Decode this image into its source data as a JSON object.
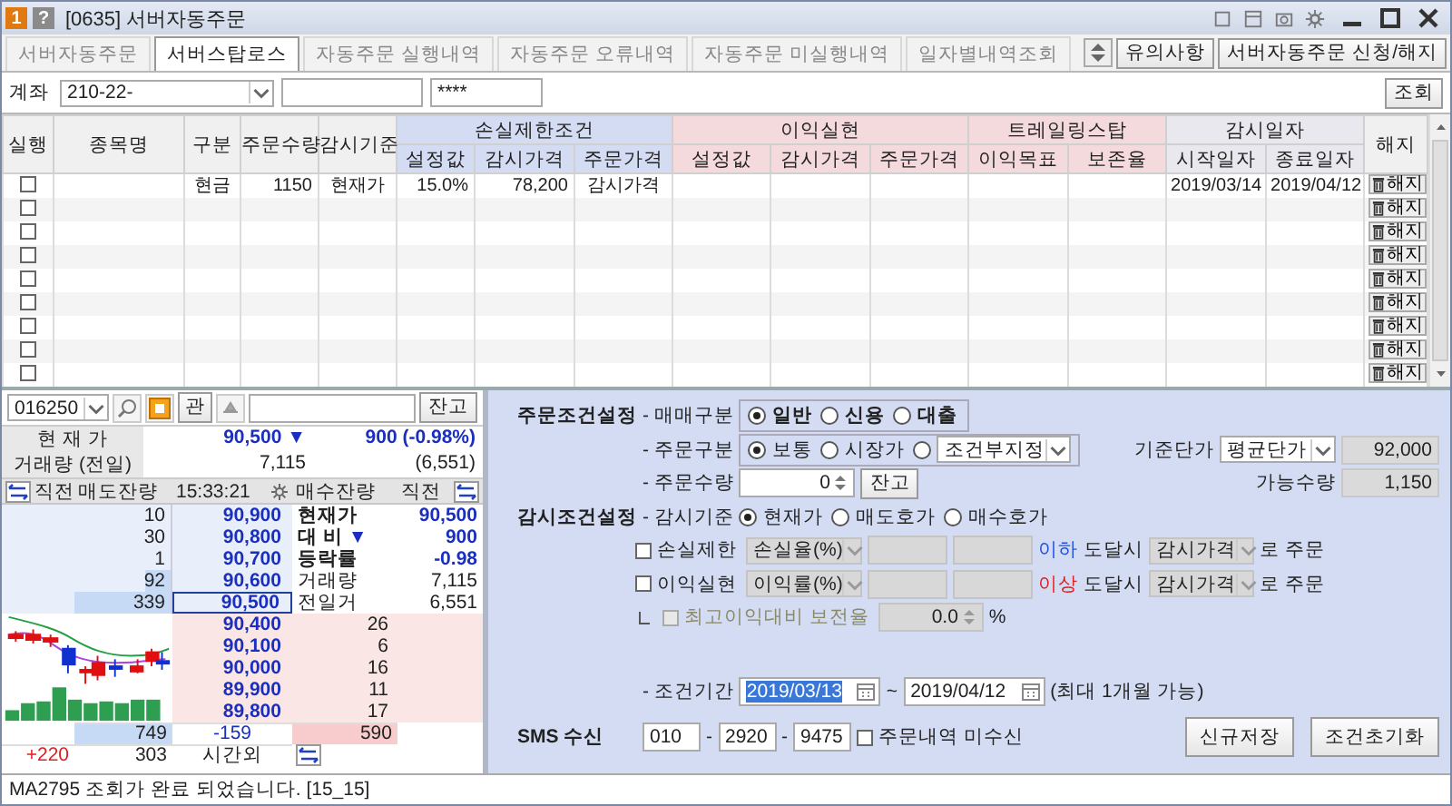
{
  "window": {
    "badge": "1",
    "help": "?",
    "title": "[0635] 서버자동주문"
  },
  "tabs": [
    {
      "label": "서버자동주문",
      "selected": false
    },
    {
      "label": "서버스탑로스",
      "selected": true
    },
    {
      "label": "자동주문 실행내역",
      "selected": false
    },
    {
      "label": "자동주문 오류내역",
      "selected": false
    },
    {
      "label": "자동주문 미실행내역",
      "selected": false
    },
    {
      "label": "일자별내역조회",
      "selected": false
    }
  ],
  "toolbar_buttons": [
    "유의사항",
    "서버자동주문 신청/해지"
  ],
  "account": {
    "label": "계좌",
    "number": "210-22-",
    "password": "****",
    "query_button": "조회"
  },
  "table": {
    "columns": [
      "실행",
      "종목명",
      "구분",
      "주문수량",
      "감시기준"
    ],
    "groups": [
      {
        "label": "손실제한조건",
        "columns": [
          "설정값",
          "감시가격",
          "주문가격"
        ]
      },
      {
        "label": "이익실현",
        "columns": [
          "설정값",
          "감시가격",
          "주문가격"
        ]
      },
      {
        "label": "트레일링스탑",
        "columns": [
          "이익목표",
          "보존율"
        ]
      },
      {
        "label": "감시일자",
        "columns": [
          "시작일자",
          "종료일자"
        ]
      }
    ],
    "last_column": "해지",
    "rows": [
      {
        "checked": false,
        "type": "현금",
        "quantity": "1150",
        "basis": "현재가",
        "loss_setting": "15.0%",
        "loss_watch_price": "78,200",
        "loss_order_price": "감시가격",
        "start_date": "2019/03/14",
        "end_date": "2019/04/12",
        "cancel": "해지"
      },
      {
        "checked": false,
        "cancel": "해지"
      },
      {
        "checked": false,
        "cancel": "해지"
      },
      {
        "checked": false,
        "cancel": "해지"
      },
      {
        "checked": false,
        "cancel": "해지"
      },
      {
        "checked": false,
        "cancel": "해지"
      },
      {
        "checked": false,
        "cancel": "해지"
      },
      {
        "checked": false,
        "cancel": "해지"
      },
      {
        "checked": false,
        "cancel": "해지"
      }
    ]
  },
  "quote": {
    "code": "016250",
    "buttons": [
      "관",
      "잔고"
    ],
    "price_label": "현 재 가",
    "price": "90,500",
    "arrow": "▼",
    "change": "900",
    "change_rate": "(-0.98%)",
    "volume_label": "거래량 (전일)",
    "volume": "7,115",
    "prev_volume": "(6,551)",
    "header": [
      "직전",
      "매도잔량",
      "15:33:21",
      "매수잔량",
      "직전"
    ],
    "asks": [
      {
        "qty": "10",
        "price": "90,900",
        "selected": false
      },
      {
        "qty": "30",
        "price": "90,800",
        "selected": false
      },
      {
        "qty": "1",
        "price": "90,700",
        "selected": false
      },
      {
        "qty": "92",
        "price": "90,600",
        "level": 0.27,
        "selected": false
      },
      {
        "qty": "339",
        "price": "90,500",
        "level": 1,
        "selected": true
      }
    ],
    "info": [
      {
        "label": "현재가",
        "value": "90,500",
        "emphasis": true
      },
      {
        "label": "대 비",
        "arrow": "▼",
        "value": "900",
        "emphasis": true
      },
      {
        "label": "등락률",
        "value": "-0.98",
        "emphasis": true
      },
      {
        "label": "거래량",
        "value": "7,115",
        "emphasis": false
      },
      {
        "label": "전일거",
        "value": "6,551",
        "emphasis": false
      }
    ],
    "bids": [
      {
        "price": "90,400",
        "qty": "26"
      },
      {
        "price": "90,100",
        "qty": "6"
      },
      {
        "price": "90,000",
        "qty": "16"
      },
      {
        "price": "89,900",
        "qty": "11"
      },
      {
        "price": "89,800",
        "qty": "17"
      }
    ],
    "totals": {
      "ask_total": "749",
      "diff": "-159",
      "bid_total": "590",
      "after_hours_prev": "+220",
      "after_hours_qty": "303",
      "after_hours_label": "시간외"
    }
  },
  "order_settings": {
    "title": "주문조건설정",
    "trade_type": {
      "label": "- 매매구분",
      "options": [
        {
          "label": "일반",
          "selected": true
        },
        {
          "label": "신용",
          "selected": false
        },
        {
          "label": "대출",
          "selected": false
        }
      ]
    },
    "order_type": {
      "label": "- 주문구분",
      "options": [
        {
          "label": "보통",
          "selected": true
        },
        {
          "label": "시장가",
          "selected": false
        },
        {
          "dropdown": "조건부지정",
          "selected": false
        }
      ]
    },
    "base_price": {
      "label": "기준단가",
      "dropdown": "평균단가",
      "value": "92,000"
    },
    "quantity": {
      "label": "- 주문수량",
      "value": "0",
      "button": "잔고"
    },
    "available": {
      "label": "가능수량",
      "value": "1,150"
    }
  },
  "watch_settings": {
    "title": "감시조건설정",
    "basis": {
      "label": "- 감시기준",
      "options": [
        {
          "label": "현재가",
          "selected": true
        },
        {
          "label": "매도호가",
          "selected": false
        },
        {
          "label": "매수호가",
          "selected": false
        }
      ]
    },
    "conditions": [
      {
        "label": "손실제한",
        "checked": false,
        "dropdown": "손실율(%)",
        "direction": "이하",
        "kind": "below",
        "reach": "도달시",
        "price_dropdown": "감시가격",
        "suffix": "로 주문"
      },
      {
        "label": "이익실현",
        "checked": false,
        "dropdown": "이익률(%)",
        "direction": "이상",
        "kind": "above",
        "reach": "도달시",
        "price_dropdown": "감시가격",
        "suffix": "로 주문"
      }
    ],
    "trailing": {
      "label": "최고이익대비 보전율",
      "checked": false,
      "disabled": true,
      "value": "0.0",
      "unit": "%"
    },
    "period": {
      "label": "- 조건기간",
      "start": "2019/03/13",
      "start_selected": true,
      "separator": "~",
      "end": "2019/04/12",
      "note": "(최대 1개월 가능)"
    }
  },
  "sms": {
    "label": "SMS 수신",
    "phone": [
      "010",
      "2920",
      "9475"
    ],
    "separator": "-",
    "opt_out": {
      "label": "주문내역 미수신",
      "checked": false
    }
  },
  "actions": [
    "신규저장",
    "조건초기화"
  ],
  "status_bar": {
    "message": "MA2795 조회가 완료 되었습니다. [15_15]"
  }
}
